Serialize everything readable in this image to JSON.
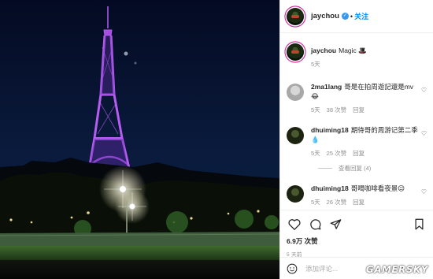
{
  "header": {
    "username": "jaychou",
    "verified_icon": "verified-badge-icon",
    "separator": "•",
    "follow_label": "关注"
  },
  "caption": {
    "username": "jaychou",
    "text": "Magic 🎩",
    "time": "5天"
  },
  "comments": [
    {
      "username": "2ma1lang",
      "text": "哥是在拍周遊記還是mv😂",
      "time": "5天",
      "likes": "38 次赞",
      "reply_label": "回复"
    },
    {
      "username": "dhuiming18",
      "text": "期待哥的周游记第二季💧",
      "time": "5天",
      "likes": "25 次赞",
      "reply_label": "回复",
      "view_replies": "查看回复 (4)"
    },
    {
      "username": "dhuiming18",
      "text": "哥喝咖啡看夜景😉",
      "time": "5天",
      "likes": "26 次赞",
      "reply_label": "回复"
    }
  ],
  "actions": {
    "icons": [
      "heart-icon",
      "comment-icon",
      "share-icon",
      "bookmark-icon"
    ],
    "likes": "6.9万 次赞",
    "time": "5 天前"
  },
  "add_comment": {
    "placeholder": "添加评论..."
  },
  "watermark": "GAMERSKY",
  "colors": {
    "link": "#0095f6",
    "tower": "#b65cf2",
    "verified": "#3897f0"
  }
}
